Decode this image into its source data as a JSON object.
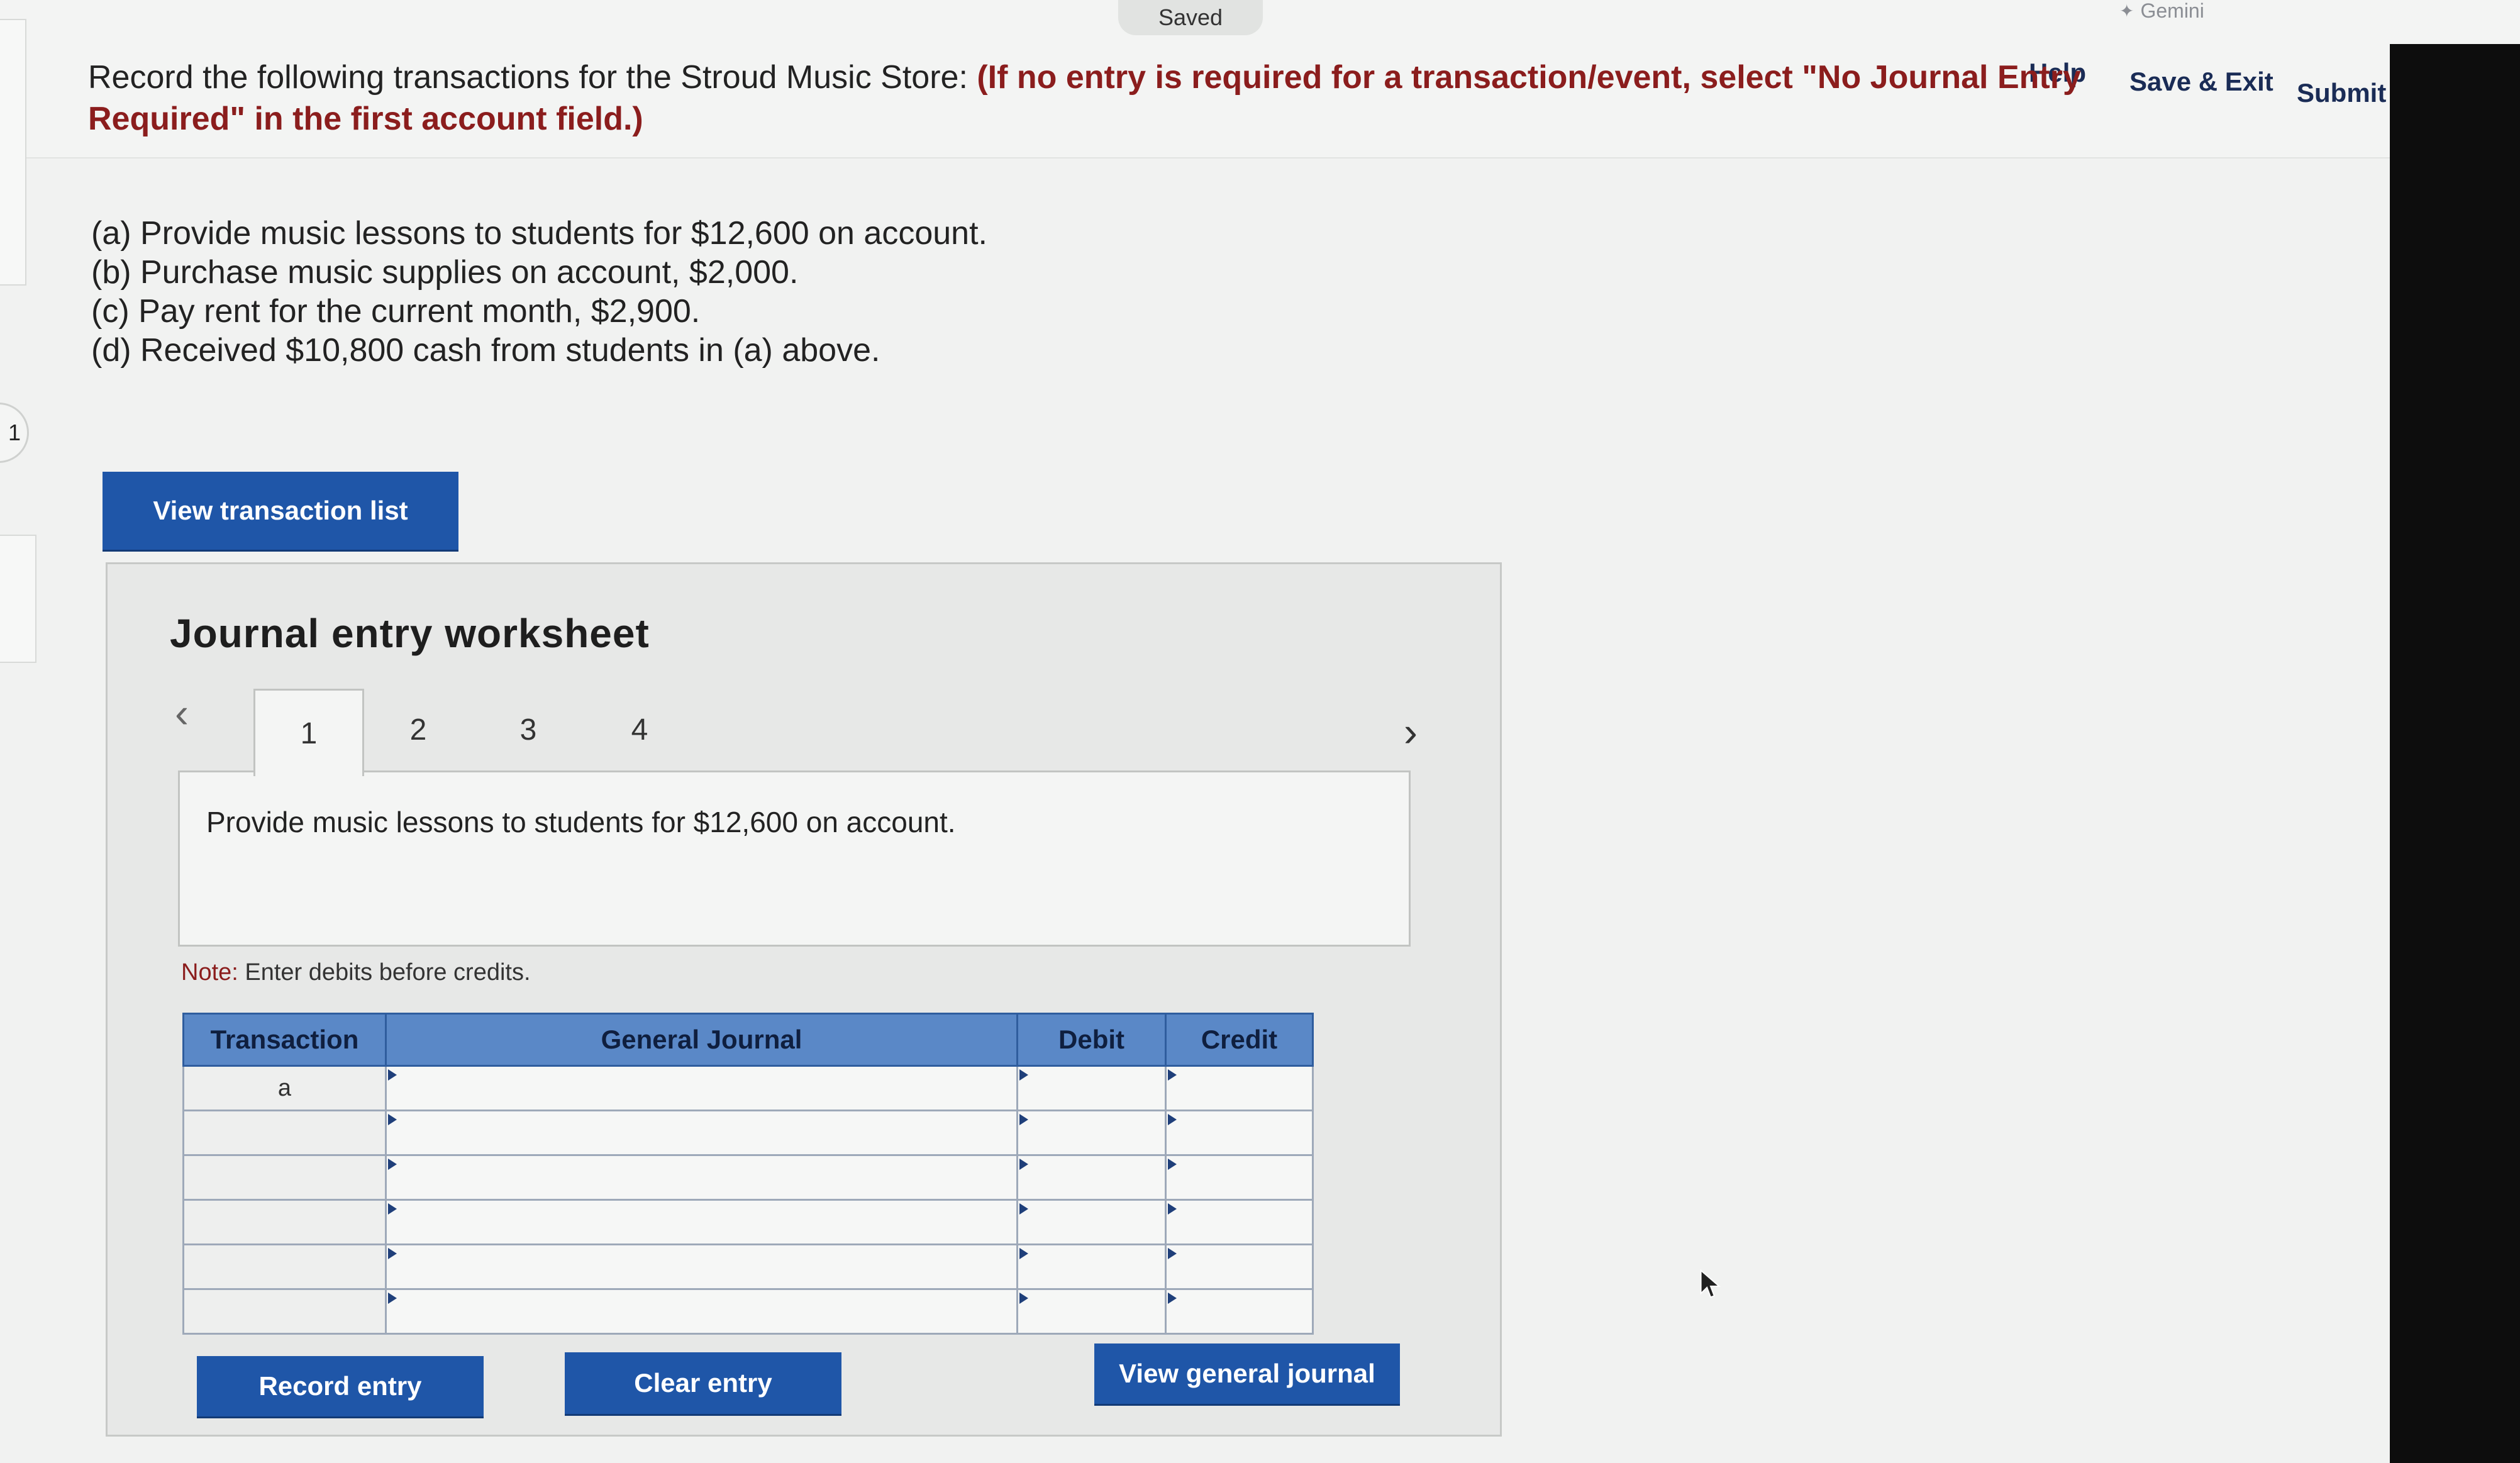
{
  "topbar": {
    "saved_label": "Saved",
    "gemini_label": "Gemini",
    "help_label": "Help",
    "save_exit_label": "Save & Exit",
    "submit_label": "Submit"
  },
  "sidebar": {
    "circle_label": "1"
  },
  "instructions": {
    "lead": "Record the following transactions for the Stroud Music Store:",
    "emphasis": "(If no entry is required for a transaction/event, select \"No Journal Entry Required\" in the first account field.)",
    "transactions": [
      "(a) Provide music lessons to students for $12,600 on account.",
      "(b) Purchase music supplies on account, $2,000.",
      "(c) Pay rent for the current month, $2,900.",
      "(d) Received $10,800 cash from students in (a) above."
    ]
  },
  "view_transaction_list_label": "View transaction list",
  "worksheet": {
    "title": "Journal entry worksheet",
    "tabs": [
      "1",
      "2",
      "3",
      "4"
    ],
    "active_tab": "1",
    "description": "Provide music lessons to students for $12,600 on account.",
    "note_label": "Note:",
    "note_text": "Enter debits before credits.",
    "table": {
      "headers": [
        "Transaction",
        "General Journal",
        "Debit",
        "Credit"
      ],
      "rows": [
        {
          "transaction": "a",
          "account": "",
          "debit": "",
          "credit": ""
        },
        {
          "transaction": "",
          "account": "",
          "debit": "",
          "credit": ""
        },
        {
          "transaction": "",
          "account": "",
          "debit": "",
          "credit": ""
        },
        {
          "transaction": "",
          "account": "",
          "debit": "",
          "credit": ""
        },
        {
          "transaction": "",
          "account": "",
          "debit": "",
          "credit": ""
        },
        {
          "transaction": "",
          "account": "",
          "debit": "",
          "credit": ""
        }
      ]
    },
    "buttons": {
      "record": "Record entry",
      "clear": "Clear entry",
      "view_general_journal": "View general journal"
    }
  },
  "colors": {
    "button_blue": "#1f56a8",
    "header_blue": "#5a88c7",
    "emphasis_red": "#8b1d1d",
    "link_navy": "#1a2c56"
  }
}
